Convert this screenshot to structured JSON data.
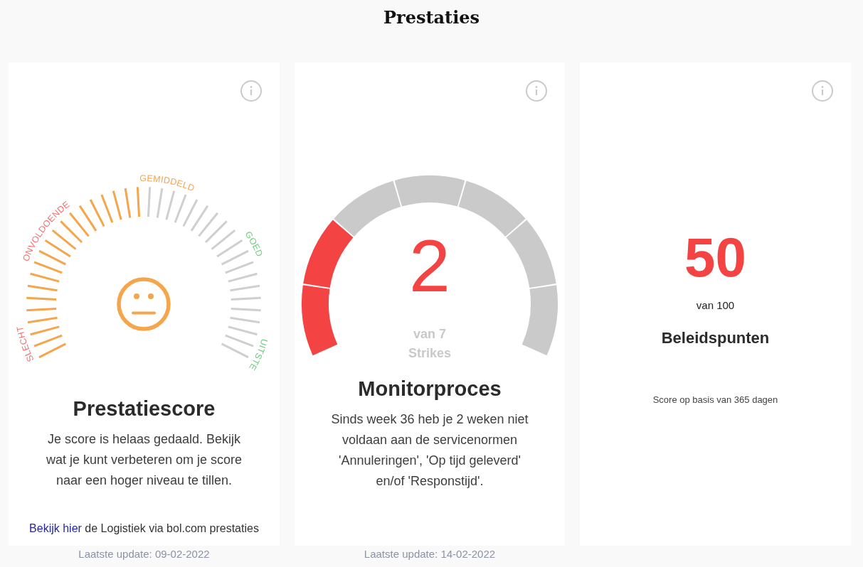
{
  "page": {
    "title": "Prestaties"
  },
  "cards": [
    {
      "kind": "tick_gauge",
      "gauge": {
        "level": 0.5,
        "labels": [
          {
            "text": "ONVOLDOENDE",
            "color": "#f27070"
          },
          {
            "text": "SLECHT",
            "color": "#f27070"
          },
          {
            "text": "GEMIDDELD",
            "color": "#f5a24c"
          },
          {
            "text": "GOED",
            "color": "#6fcf7f"
          },
          {
            "text": "UITSTE",
            "color": "#6fcf7f"
          }
        ]
      },
      "title": "Prestatiescore",
      "description": "Je score is helaas gedaald. Bekijk wat je kunt verbeteren om je score naar een hoger niveau te tillen.",
      "footer": {
        "link": "Bekijk hier",
        "text": "de Logistiek via bol.com prestaties"
      },
      "last_update": "Laatste update: 09-02-2022"
    },
    {
      "kind": "segment_gauge",
      "gauge": {
        "value": "2",
        "caption_lines": [
          "van 7",
          "Strikes"
        ],
        "segments": [
          {
            "filled": true
          },
          {
            "filled": true
          },
          {
            "filled": false
          },
          {
            "filled": false
          },
          {
            "filled": false
          },
          {
            "filled": false
          },
          {
            "filled": false
          }
        ]
      },
      "title": "Monitorproces",
      "description": "Sinds week 36 heb je 2 weken niet voldaan aan de servicenormen 'Annuleringen', 'Op tijd geleverd' en/of 'Responstijd'.",
      "last_update": "Laatste update: 14-02-2022"
    },
    {
      "kind": "score",
      "score": {
        "value": "50",
        "caption": "van 100"
      },
      "title": "Beleidspunten",
      "note": "Score op basis van 365 dagen"
    }
  ]
}
